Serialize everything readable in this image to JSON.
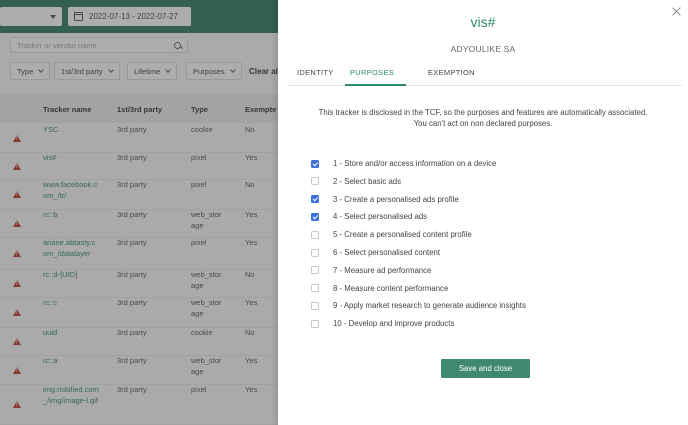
{
  "background": {
    "date_range": "2022-07-13 - 2022-07-27",
    "search_placeholder": "Tracker or vendor name",
    "filters": [
      "Type",
      "1st/3rd party",
      "Lifetime",
      "Purposes"
    ],
    "clear_all": "Clear all",
    "columns": [
      "Tracker name",
      "1st/3rd party",
      "Type",
      "Exempte"
    ],
    "rows": [
      {
        "name": "YSC",
        "party": "3rd party",
        "type": "cookie",
        "exempt": "No"
      },
      {
        "name": "vis#",
        "party": "3rd party",
        "type": "pixel",
        "exempt": "Yes"
      },
      {
        "name": "www.facebook.com_/tr/",
        "party": "3rd party",
        "type": "pixel",
        "exempt": "No"
      },
      {
        "name": "rc::b",
        "party": "3rd party",
        "type": "web_storage",
        "exempt": "Yes"
      },
      {
        "name": "ariane.abtasty.com_/datalayer",
        "party": "3rd party",
        "type": "pixel",
        "exempt": "Yes"
      },
      {
        "name": "rc::d-[UID]",
        "party": "3rd party",
        "type": "web_storage",
        "exempt": "No"
      },
      {
        "name": "rc::c",
        "party": "3rd party",
        "type": "web_storage",
        "exempt": "Yes"
      },
      {
        "name": "uuid",
        "party": "3rd party",
        "type": "cookie",
        "exempt": "No"
      },
      {
        "name": "rc::a",
        "party": "3rd party",
        "type": "web_storage",
        "exempt": "Yes"
      },
      {
        "name": "img.riskified.com_/img/image-l.gif",
        "party": "3rd party",
        "type": "pixel",
        "exempt": "Yes"
      }
    ]
  },
  "modal": {
    "title": "vis#",
    "subtitle": "ADYOULIKE SA",
    "tabs": [
      {
        "label": "IDENTITY",
        "active": false
      },
      {
        "label": "PURPOSES",
        "active": true
      },
      {
        "label": "EXEMPTION",
        "active": false
      }
    ],
    "info_line1": "This tracker is disclosed in the TCF, so the purposes and features are automatically associated.",
    "info_line2": "You can't act on non declared purposes.",
    "purposes": [
      {
        "label": "1 - Store and/or access information on a device",
        "checked": true
      },
      {
        "label": "2 - Select basic ads",
        "checked": false
      },
      {
        "label": "3 - Create a personalised ads profile",
        "checked": true
      },
      {
        "label": "4 - Select personalised ads",
        "checked": true
      },
      {
        "label": "5 - Create a personalised content profile",
        "checked": false
      },
      {
        "label": "6 - Select personalised content",
        "checked": false
      },
      {
        "label": "7 - Measure ad performance",
        "checked": false
      },
      {
        "label": "8 - Measure content performance",
        "checked": false
      },
      {
        "label": "9 - Apply market research to generate audience insights",
        "checked": false
      },
      {
        "label": "10 - Develop and improve products",
        "checked": false
      }
    ],
    "save_label": "Save and close"
  },
  "colors": {
    "brand": "#2f7a63",
    "link": "#2f8a68",
    "checkbox": "#3f6fd9",
    "warning": "#c0392b"
  },
  "icons": [
    "calendar-icon",
    "search-icon",
    "chevron-down-icon",
    "warning-icon",
    "close-icon",
    "checkbox-checked-icon"
  ]
}
